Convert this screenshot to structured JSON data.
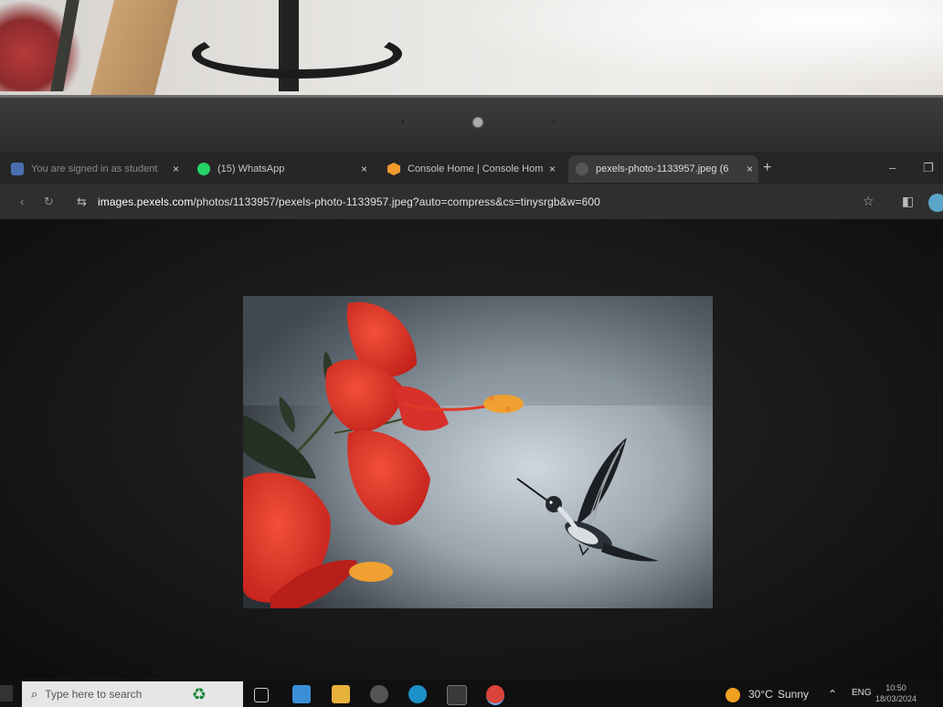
{
  "browser": {
    "tabs": [
      {
        "title": "You are signed in as student",
        "favicon_color": "#4a6fb0",
        "active": false
      },
      {
        "title": "(15) WhatsApp",
        "favicon_color": "#25d366",
        "active": false
      },
      {
        "title": "Console Home | Console Hom",
        "favicon_color": "#f29a2e",
        "active": false
      },
      {
        "title": "pexels-photo-1133957.jpeg (6",
        "favicon_color": "#555555",
        "active": true
      }
    ],
    "new_tab_label": "+",
    "close_label": "×",
    "url_host": "images.pexels.com",
    "url_path": "/photos/1133957/pexels-photo-1133957.jpeg?auto=compress&cs=tinysrgb&w=600",
    "window_controls": {
      "minimize": "–",
      "restore": "❐"
    }
  },
  "icons": {
    "reload": "reload-icon",
    "site_info": "site-info-icon",
    "bookmark": "star-icon",
    "sidepanel": "side-panel-icon"
  },
  "taskbar": {
    "search_placeholder": "Type here to search",
    "weather_temp": "30°C",
    "weather_text": "Sunny",
    "language": "ENG",
    "time": "10:50",
    "date": "18/03/2024"
  },
  "colors": {
    "accent": "#6cb4ff",
    "flower": "#e0372a",
    "stamen": "#f0a030"
  }
}
